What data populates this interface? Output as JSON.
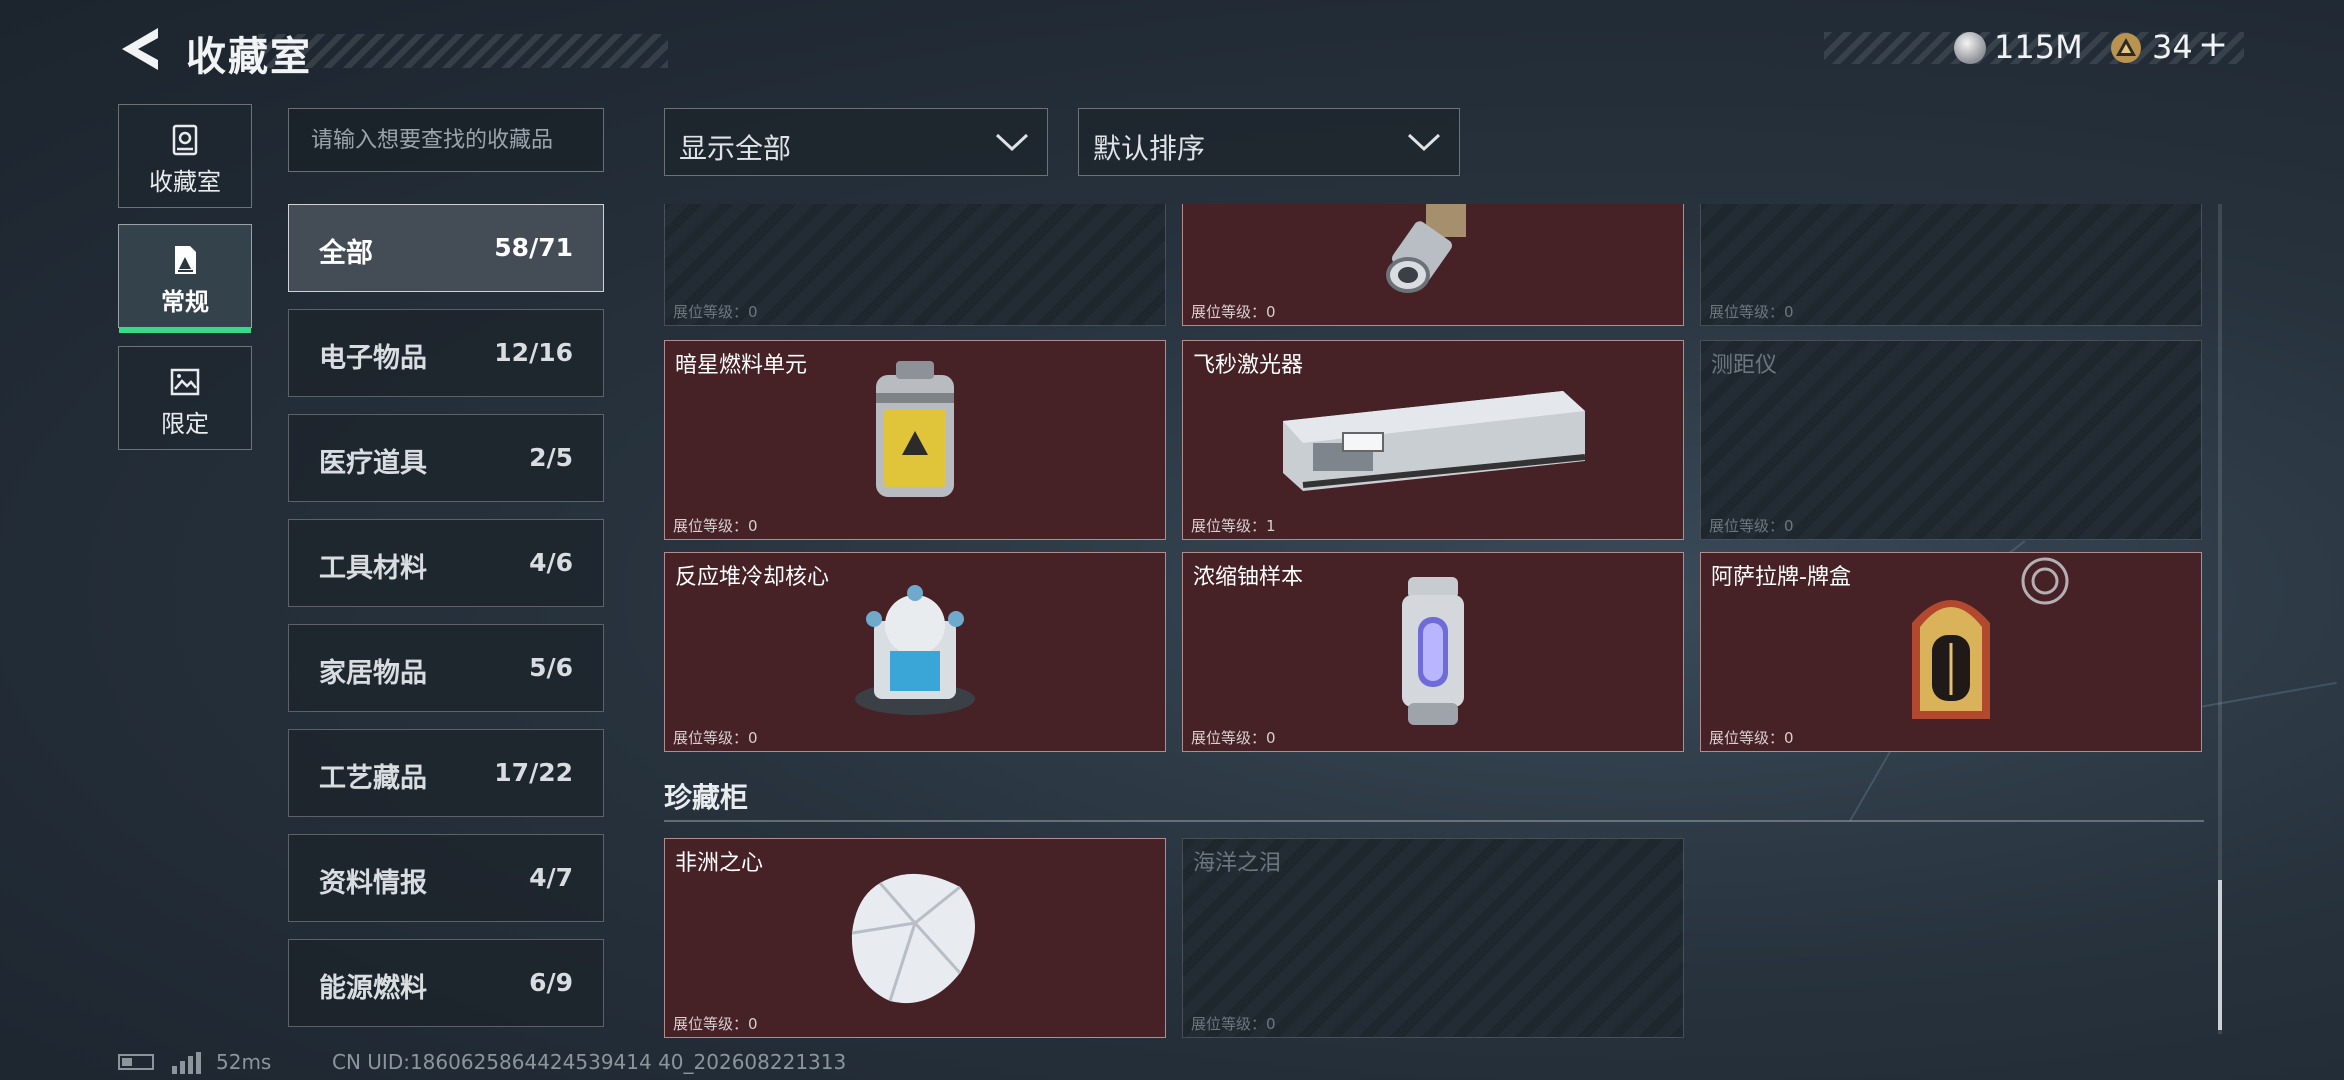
{
  "header": {
    "title": "收藏室",
    "currency_silver": "115M",
    "currency_gold": "34",
    "add_symbol": "+"
  },
  "nav": [
    {
      "label": "收藏室",
      "icon": "cabinet-icon",
      "active": false
    },
    {
      "label": "常规",
      "icon": "document-icon",
      "active": true
    },
    {
      "label": "限定",
      "icon": "image-icon",
      "active": false
    }
  ],
  "search": {
    "placeholder": "请输入想要查找的收藏品"
  },
  "categories": [
    {
      "name": "全部",
      "count": "58/71"
    },
    {
      "name": "电子物品",
      "count": "12/16"
    },
    {
      "name": "医疗道具",
      "count": "2/5"
    },
    {
      "name": "工具材料",
      "count": "4/6"
    },
    {
      "name": "家居物品",
      "count": "5/6"
    },
    {
      "name": "工艺藏品",
      "count": "17/22"
    },
    {
      "name": "资料情报",
      "count": "4/7"
    },
    {
      "name": "能源燃料",
      "count": "6/9"
    }
  ],
  "filters": {
    "show": "显示全部",
    "sort": "默认排序"
  },
  "level_label": "展位等级：",
  "grid_items": [
    {
      "name": "",
      "level": "0",
      "owned": false
    },
    {
      "name": "",
      "level": "0",
      "owned": true
    },
    {
      "name": "",
      "level": "0",
      "owned": false
    },
    {
      "name": "暗星燃料单元",
      "level": "0",
      "owned": true
    },
    {
      "name": "飞秒激光器",
      "level": "1",
      "owned": true
    },
    {
      "name": "测距仪",
      "level": "0",
      "owned": false
    },
    {
      "name": "反应堆冷却核心",
      "level": "0",
      "owned": true
    },
    {
      "name": "浓缩铀样本",
      "level": "0",
      "owned": true
    },
    {
      "name": "阿萨拉牌-牌盒",
      "level": "0",
      "owned": true
    }
  ],
  "section": {
    "title": "珍藏柜"
  },
  "treasure_items": [
    {
      "name": "非洲之心",
      "level": "0",
      "owned": true
    },
    {
      "name": "海洋之泪",
      "level": "0",
      "owned": false
    }
  ],
  "footer": {
    "ping": "52ms",
    "uid": "CN UID:1860625864424539414 40_202608221313"
  },
  "colors": {
    "owned_bg": "#462126",
    "accent_green": "#39d98a",
    "locked_bg": "#1f272e"
  }
}
